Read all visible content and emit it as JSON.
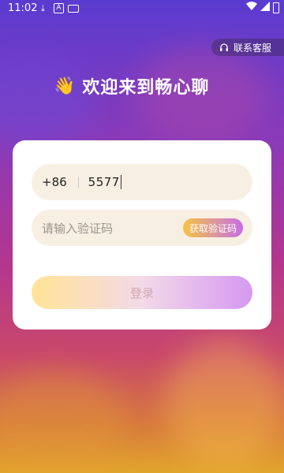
{
  "status_bar": {
    "time": "11:02",
    "notif_a_letter": "A"
  },
  "header": {
    "contact_label": "联系客服",
    "welcome_text": "欢迎来到畅心聊",
    "wave_emoji": "👋"
  },
  "form": {
    "country_code": "+86",
    "phone_value": "5577",
    "code_placeholder": "请输入验证码",
    "get_code_label": "获取验证码",
    "login_label": "登录"
  },
  "icons": {
    "download": "download-icon",
    "headset": "headset-icon",
    "wifi": "wifi-icon",
    "signal": "signal-icon",
    "battery": "battery-icon"
  }
}
